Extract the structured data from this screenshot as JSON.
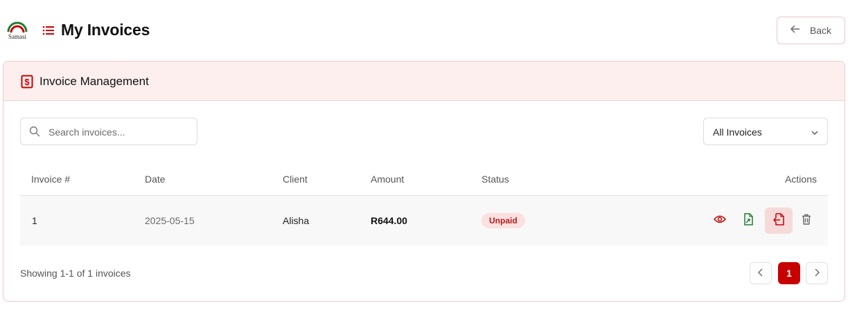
{
  "brand": {
    "logo_text": "Samasi",
    "accent": "#c70000",
    "logo_green": "#1e7d32"
  },
  "header": {
    "title": "My Invoices",
    "title_icon": "list-icon",
    "back_label": "Back",
    "back_icon": "arrow-left-icon"
  },
  "card": {
    "title": "Invoice Management",
    "title_icon": "dollar-document-icon"
  },
  "search": {
    "placeholder": "Search invoices...",
    "value": "",
    "icon": "search-icon"
  },
  "filter": {
    "selected": "All Invoices",
    "icon": "chevron-down-icon"
  },
  "table": {
    "columns": [
      "Invoice #",
      "Date",
      "Client",
      "Amount",
      "Status",
      "Actions"
    ],
    "rows": [
      {
        "invoice": "1",
        "date": "2025-05-15",
        "client": "Alisha",
        "amount": "R644.00",
        "status": "Unpaid"
      }
    ],
    "actions": [
      "eye-icon",
      "file-export-icon",
      "file-import-icon",
      "trash-icon"
    ]
  },
  "footer": {
    "showing": "Showing 1-1 of 1 invoices"
  },
  "pagination": {
    "current": "1",
    "prev_icon": "chevron-left-icon",
    "next_icon": "chevron-right-icon"
  }
}
